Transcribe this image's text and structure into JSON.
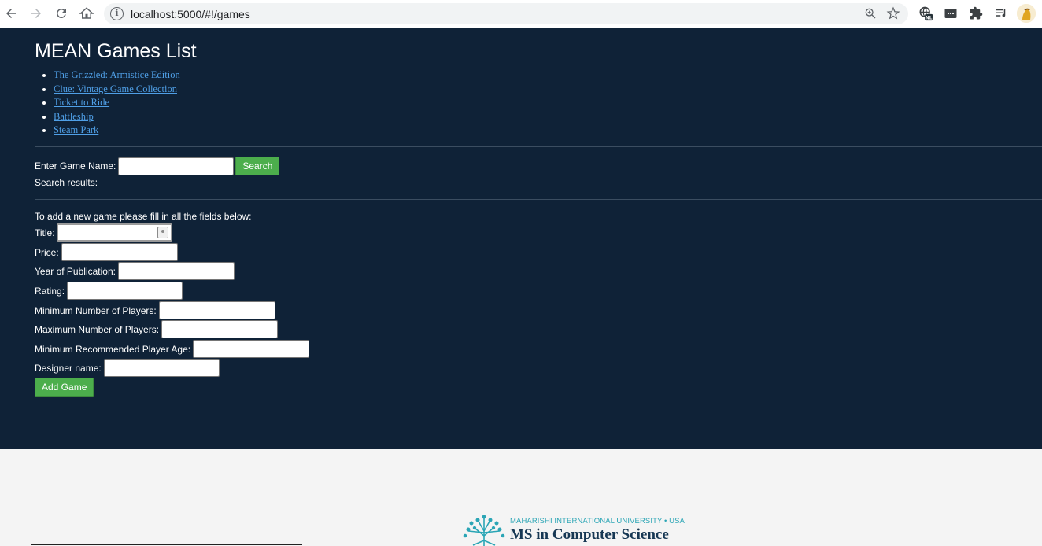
{
  "browser": {
    "url": "localhost:5000/#!/games",
    "extension_badge": "NL"
  },
  "page": {
    "title": "MEAN Games List",
    "games": [
      "The Grizzled: Armistice Edition",
      "Clue: Vintage Game Collection",
      "Ticket to Ride",
      "Battleship",
      "Steam Park"
    ],
    "search": {
      "label": "Enter Game Name:",
      "value": "",
      "button": "Search",
      "results_label": "Search results:"
    },
    "add_form": {
      "intro": "To add a new game please fill in all the fields below:",
      "fields": {
        "title": "Title:",
        "price": "Price:",
        "year": "Year of Publication:",
        "rating": "Rating:",
        "min_players": "Minimum Number of Players:",
        "max_players": "Maximum Number of Players:",
        "min_age": "Minimum Recommended Player Age:",
        "designer": "Designer name:"
      },
      "submit": "Add Game"
    }
  },
  "footer": {
    "university": "MAHARISHI INTERNATIONAL UNIVERSITY • USA",
    "program": "MS in Computer Science"
  },
  "colors": {
    "page_bg": "#0f2237",
    "link": "#4f9fe6",
    "button": "#4cae4c",
    "footer_bg": "#f4f4f4",
    "logo_teal": "#2aa5b5",
    "logo_navy": "#163753"
  }
}
